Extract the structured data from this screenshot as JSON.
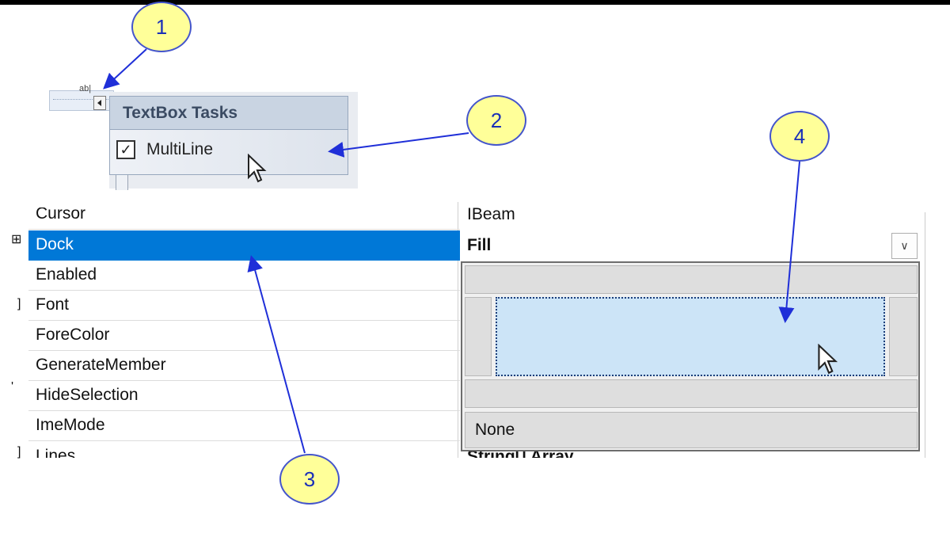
{
  "tasks_panel": {
    "title": "TextBox Tasks",
    "multiline_label": "MultiLine",
    "multiline_checked": true,
    "check_glyph": "✓"
  },
  "smart_tag": {
    "glyph": "ab|"
  },
  "property_grid": {
    "rows": [
      {
        "name": "Cursor",
        "value": "IBeam",
        "bold": false
      },
      {
        "name": "Dock",
        "value": "Fill",
        "bold": true,
        "selected": true
      },
      {
        "name": "Enabled",
        "value": ""
      },
      {
        "name": "Font",
        "value": ""
      },
      {
        "name": "ForeColor",
        "value": ""
      },
      {
        "name": "GenerateMember",
        "value": ""
      },
      {
        "name": "HideSelection",
        "value": ""
      },
      {
        "name": "ImeMode",
        "value": ""
      },
      {
        "name": "Lines",
        "value": "String[] Array",
        "bold": true
      }
    ],
    "dropdown_icon": "chevron-down-icon"
  },
  "dock_editor": {
    "none_label": "None",
    "selected": "Fill"
  },
  "callouts": [
    "1",
    "2",
    "3",
    "4"
  ],
  "colors": {
    "selection": "#0078d7",
    "callout_fill": "#ffff99",
    "arrow": "#1f2fd8",
    "fill_selected": "#cce4f7"
  }
}
